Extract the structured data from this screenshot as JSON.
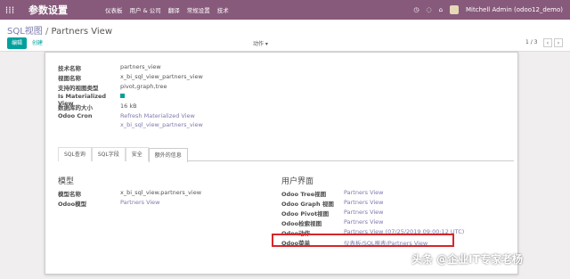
{
  "navbar": {
    "app_title": "参数设置",
    "menu": [
      "仪表板",
      "用户 & 公司",
      "翻译",
      "常规设置",
      "技术"
    ],
    "user": "Mitchell Admin (odoo12_demo)"
  },
  "control": {
    "breadcrumb_link": "SQL视图",
    "breadcrumb_sep": "/",
    "breadcrumb_current": "Partners View",
    "edit_label": "编辑",
    "create_label": "创建",
    "action_label": "动作 ▾",
    "pager": "1 / 3",
    "prev": "‹",
    "next": "›"
  },
  "fields": {
    "tech_name_label": "技术名称",
    "tech_name_value": "partners_view",
    "view_name_label": "视图名称",
    "view_name_value": "x_bi_sql_view_partners_view",
    "view_types_label": "支持的视图类型",
    "view_types_value": "pivot,graph,tree",
    "materialized_label": "Is Materialized View",
    "db_size_label": "数据库的大小",
    "db_size_value": "16 kB",
    "cron_label": "Odoo Cron",
    "cron_value_1": "Refresh Materialized View",
    "cron_value_2": "x_bi_sql_view_partners_view"
  },
  "tabs": [
    "SQL查询",
    "SQL字段",
    "安全",
    "额外的信息"
  ],
  "model_section": {
    "title": "模型",
    "model_name_label": "模型名称",
    "model_name_value": "x_bi_sql_view.partners_view",
    "odoo_model_label": "Odoo模型",
    "odoo_model_value": "Partners View"
  },
  "ui_section": {
    "title": "用户界面",
    "tree_label": "Odoo Tree视图",
    "tree_value": "Partners View",
    "graph_label": "Odoo Graph 视图",
    "graph_value": "Partners View",
    "pivot_label": "Odoo Pivot视图",
    "pivot_value": "Partners View",
    "search_label": "Odoo检索视图",
    "search_value": "Partners View",
    "action_label": "Odoo动作",
    "action_value": "Partners View (07/25/2019 09:00:12 UTC)",
    "menu_label": "Odoo菜单",
    "menu_value": "仪表板/SQL报表/Partners View"
  },
  "watermark": "头条 @企业IT专家老杨",
  "colors": {
    "navbar": "#875a7b",
    "primary": "#00a09d",
    "link": "#7c7bad",
    "highlight": "#d6262a"
  }
}
